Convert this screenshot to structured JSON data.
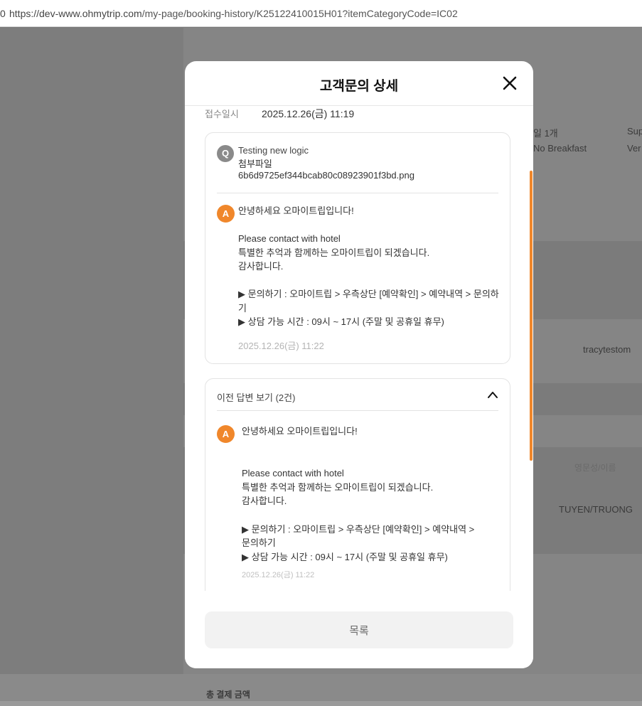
{
  "browser": {
    "left_fragment": "0",
    "url_host": "https://dev-www.ohmytrip.com",
    "url_path": "/my-page/booking-history/K25122410015H01?itemCategoryCode=IC02"
  },
  "background": {
    "texts": [
      "일 1개",
      "No Breakfast",
      "Sup",
      "Ver",
      "tracytestom",
      "영문성/이름",
      "TUYEN/TRUONG",
      "총 결제 금액"
    ]
  },
  "modal": {
    "title": "고객문의 상세",
    "received_label": "접수일시",
    "received_value": "2025.12.26(금) 11:19",
    "question": {
      "badge": "Q",
      "title": "Testing new logic",
      "attachment_label": "첨부파일",
      "attachment_name": "6b6d9725ef344bcab80c08923901f3bd.png"
    },
    "answer": {
      "badge": "A",
      "lines": [
        "안녕하세요 오마이트립입니다!",
        "",
        "Please contact with hotel",
        "특별한 추억과 함께하는 오마이트립이 되겠습니다.",
        "감사합니다.",
        "",
        "▶ 문의하기 : 오마이트립 > 우측상단 [예약확인] > 예약내역 > 문의하",
        "기",
        "▶ 상담 가능 시간 : 09시 ~ 17시 (주말 및 공휴일 휴무)"
      ],
      "date": "2025.12.26(금) 11:22"
    },
    "previous": {
      "label": "이전 답변 보기 (2건)",
      "answer": {
        "badge": "A",
        "lines": [
          "안녕하세요 오마이트립입니다!",
          "",
          "",
          "Please contact with hotel",
          "특별한 추억과 함께하는 오마이트립이 되겠습니다.",
          "감사합니다.",
          "",
          "▶ 문의하기 : 오마이트립 > 우측상단 [예약확인] > 예약내역 >",
          "문의하기",
          "▶ 상담 가능 시간 : 09시 ~ 17시 (주말 및 공휴일 휴무)"
        ],
        "date": "2025.12.26(금) 11:22"
      }
    },
    "list_button": "목록"
  },
  "colors": {
    "accent": "#f0872b",
    "question_badge": "#8a8a8a",
    "overlay": "#7d7d7d"
  },
  "icons": {
    "close": "close-icon",
    "chevron": "chevron-up-icon"
  }
}
